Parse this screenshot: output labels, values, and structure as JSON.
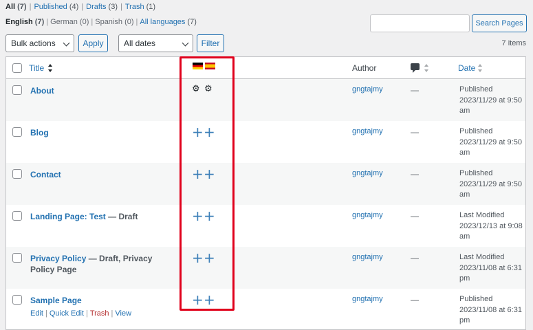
{
  "status_filters": [
    {
      "label": "All",
      "count": "(7)",
      "current": true
    },
    {
      "label": "Published",
      "count": "(4)",
      "current": false
    },
    {
      "label": "Drafts",
      "count": "(3)",
      "current": false
    },
    {
      "label": "Trash",
      "count": "(1)",
      "current": false
    }
  ],
  "lang_filters": {
    "english": {
      "label": "English",
      "count": "(7)"
    },
    "german": {
      "label": "German",
      "count": "(0)"
    },
    "spanish": {
      "label": "Spanish",
      "count": "(0)"
    },
    "all": {
      "label": "All languages",
      "count": "(7)"
    }
  },
  "search": {
    "button": "Search Pages",
    "value": ""
  },
  "tablenav": {
    "bulk_actions": "Bulk actions",
    "apply": "Apply",
    "dates": "All dates",
    "filter": "Filter",
    "items": "7 items"
  },
  "columns": {
    "title": "Title",
    "author": "Author",
    "date": "Date"
  },
  "flags": [
    "german-flag-icon",
    "spanish-flag-icon"
  ],
  "rows": [
    {
      "title": "About",
      "state": "",
      "author": "gngtajmy",
      "comments": "—",
      "date_status": "Published",
      "date_line2": "2023/11/29 at 9:50",
      "date_line3": "am",
      "lang": "edit"
    },
    {
      "title": "Blog",
      "state": "",
      "author": "gngtajmy",
      "comments": "—",
      "date_status": "Published",
      "date_line2": "2023/11/29 at 9:50",
      "date_line3": "am",
      "lang": "add"
    },
    {
      "title": "Contact",
      "state": "",
      "author": "gngtajmy",
      "comments": "—",
      "date_status": "Published",
      "date_line2": "2023/11/29 at 9:50",
      "date_line3": "am",
      "lang": "add"
    },
    {
      "title": "Landing Page: Test",
      "state": " — Draft",
      "author": "gngtajmy",
      "comments": "—",
      "date_status": "Last Modified",
      "date_line2": "2023/12/13 at 9:08",
      "date_line3": "am",
      "lang": "add"
    },
    {
      "title": "Privacy Policy",
      "state": " — Draft, Privacy Policy Page",
      "author": "gngtajmy",
      "comments": "—",
      "date_status": "Last Modified",
      "date_line2": "2023/11/08 at 6:31",
      "date_line3": "pm",
      "lang": "add"
    },
    {
      "title": "Sample Page",
      "state": "",
      "author": "gngtajmy",
      "comments": "—",
      "date_status": "Published",
      "date_line2": "2023/11/08 at 6:31",
      "date_line3": "pm",
      "lang": "add"
    }
  ],
  "row_actions": {
    "edit": "Edit",
    "quick_edit": "Quick Edit",
    "trash": "Trash",
    "view": "View"
  },
  "glyphs": {
    "gear": "⚙",
    "plus": "+"
  },
  "colors": {
    "link": "#2271b1",
    "highlight": "#e0001b",
    "trash": "#b32d2e"
  }
}
